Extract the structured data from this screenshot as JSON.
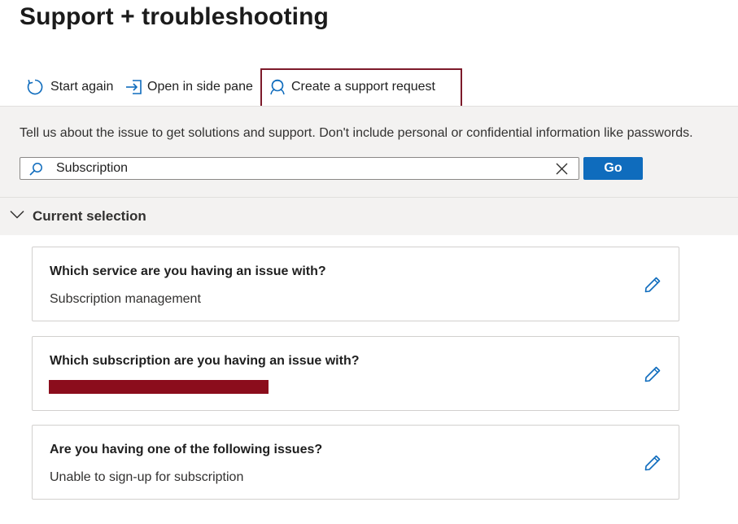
{
  "page": {
    "title": "Support + troubleshooting"
  },
  "toolbar": {
    "start_again": "Start again",
    "open_side_pane": "Open in side pane",
    "create_support_request": "Create a support request"
  },
  "instructions": {
    "text": "Tell us about the issue to get solutions and support. Don't include personal or confidential information like passwords."
  },
  "search": {
    "value": "Subscription",
    "go_label": "Go"
  },
  "current_selection": {
    "title": "Current selection",
    "cards": [
      {
        "question": "Which service are you having an issue with?",
        "answer": "Subscription management"
      },
      {
        "question": "Which subscription are you having an issue with?",
        "answer": ""
      },
      {
        "question": "Are you having one of the following issues?",
        "answer": "Unable to sign-up for subscription"
      }
    ]
  },
  "colors": {
    "accent": "#0f6cbd",
    "highlight_border": "#7d1a2a",
    "redaction": "#8b0d1c",
    "panel_bg": "#f3f2f1"
  },
  "icons": {
    "start_again": "refresh-icon",
    "open_side_pane": "open-side-pane-icon",
    "create_support_request": "support-person-icon",
    "search": "search-icon",
    "clear": "close-icon",
    "collapse": "chevron-down-icon",
    "edit": "pencil-icon"
  }
}
